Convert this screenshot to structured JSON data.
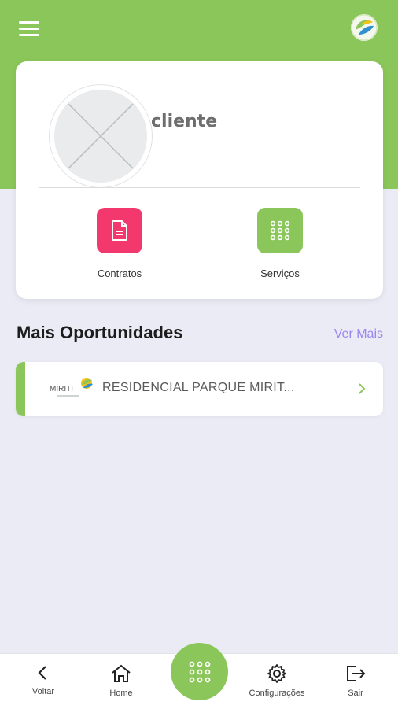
{
  "profile": {
    "username": "cliente"
  },
  "actions": [
    {
      "label": "Contratos",
      "icon": "document-icon",
      "color": "#f2386c"
    },
    {
      "label": "Serviços",
      "icon": "grid-icon",
      "color": "#8bc65a"
    }
  ],
  "opportunities": {
    "title": "Mais Oportunidades",
    "see_more": "Ver Mais",
    "items": [
      {
        "name": "RESIDENCIAL PARQUE MIRIT...",
        "logo_text": "MIRITI"
      }
    ]
  },
  "nav": {
    "back": "Voltar",
    "home": "Home",
    "settings": "Configurações",
    "exit": "Sair"
  },
  "colors": {
    "brand_green": "#8bc65a",
    "accent_pink": "#f2386c",
    "link_purple": "#9b86f0"
  }
}
